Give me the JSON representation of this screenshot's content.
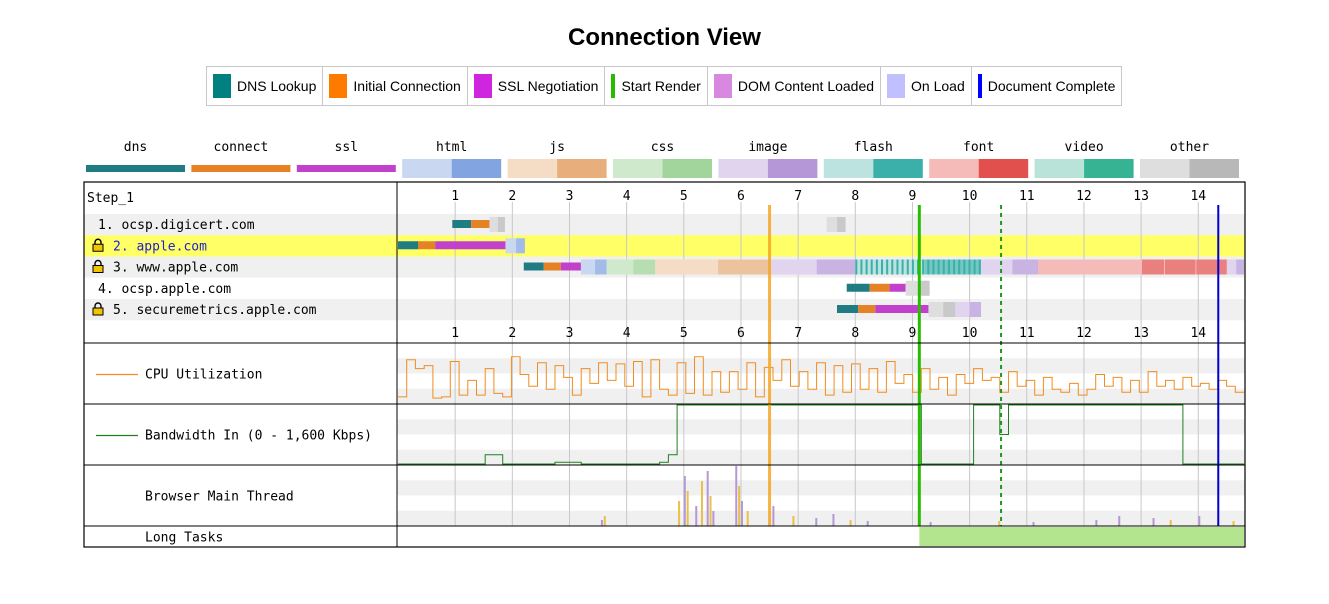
{
  "title": "Connection View",
  "legend": [
    {
      "label": "DNS Lookup",
      "color": "#008080",
      "kind": "box"
    },
    {
      "label": "Initial Connection",
      "color": "#ff7b00",
      "kind": "box"
    },
    {
      "label": "SSL Negotiation",
      "color": "#cf25df",
      "kind": "box"
    },
    {
      "label": "Start Render",
      "color": "#28bc00",
      "kind": "line"
    },
    {
      "label": "DOM Content Loaded",
      "color": "#d888df",
      "kind": "box"
    },
    {
      "label": "On Load",
      "color": "#c0c0ff",
      "kind": "box"
    },
    {
      "label": "Document Complete",
      "color": "#0000ff",
      "kind": "line"
    }
  ],
  "type_legend": [
    {
      "label": "dns",
      "light": "#1f7c83",
      "dark": "#1f7c83",
      "solid": true
    },
    {
      "label": "connect",
      "light": "#e58226",
      "dark": "#e58226",
      "solid": true
    },
    {
      "label": "ssl",
      "light": "#c141cd",
      "dark": "#c141cd",
      "solid": true
    },
    {
      "label": "html",
      "light": "#c9d7f1",
      "dark": "#82a4e0"
    },
    {
      "label": "js",
      "light": "#f4dcc5",
      "dark": "#e8ae7b"
    },
    {
      "label": "css",
      "light": "#cfe9cc",
      "dark": "#a2d59b"
    },
    {
      "label": "image",
      "light": "#e0d4ef",
      "dark": "#b597d7"
    },
    {
      "label": "flash",
      "light": "#bde3e1",
      "dark": "#3bb0aa"
    },
    {
      "label": "font",
      "light": "#f4bbb8",
      "dark": "#e2504d"
    },
    {
      "label": "video",
      "light": "#b9e2d9",
      "dark": "#36b392"
    },
    {
      "label": "other",
      "light": "#dedede",
      "dark": "#b8b8b8"
    }
  ],
  "step_label": "Step_1",
  "rows": [
    {
      "label": "1. ocsp.digicert.com",
      "secure": false,
      "highlight": false
    },
    {
      "label": "2. apple.com",
      "secure": true,
      "highlight": true
    },
    {
      "label": "3. www.apple.com",
      "secure": true,
      "highlight": false
    },
    {
      "label": "4. ocsp.apple.com",
      "secure": false,
      "highlight": false
    },
    {
      "label": "5. securemetrics.apple.com",
      "secure": true,
      "highlight": false
    }
  ],
  "metric_rows": [
    {
      "label": "CPU Utilization",
      "color": "#f28c1f"
    },
    {
      "label": "Bandwidth In (0 - 1,600 Kbps)",
      "color": "#208020"
    },
    {
      "label": "Browser Main Thread",
      "color": ""
    },
    {
      "label": "Long Tasks",
      "color": ""
    }
  ],
  "chart_data": {
    "type": "waterfall",
    "x_unit": "seconds",
    "xlim": [
      0,
      14.8
    ],
    "ticks": [
      1,
      2,
      3,
      4,
      5,
      6,
      7,
      8,
      9,
      10,
      11,
      12,
      13,
      14
    ],
    "events": {
      "start_render": 9.12,
      "dom_content_loaded_dashed": 10.55,
      "document_complete": 14.35,
      "orange_marker": 6.5
    },
    "connections": [
      {
        "row": 0,
        "segments": [
          {
            "kind": "dns",
            "start": 0.95,
            "end": 1.28
          },
          {
            "kind": "connect",
            "start": 1.28,
            "end": 1.6
          },
          {
            "kind": "other",
            "start": 1.6,
            "end": 1.87
          },
          {
            "kind": "other",
            "start": 7.5,
            "end": 7.83
          }
        ]
      },
      {
        "row": 1,
        "segments": [
          {
            "kind": "dns",
            "start": 0.0,
            "end": 0.35
          },
          {
            "kind": "connect",
            "start": 0.35,
            "end": 0.65
          },
          {
            "kind": "ssl",
            "start": 0.65,
            "end": 1.88
          },
          {
            "kind": "html",
            "start": 1.88,
            "end": 2.22
          }
        ]
      },
      {
        "row": 2,
        "segments": [
          {
            "kind": "dns",
            "start": 2.2,
            "end": 2.55
          },
          {
            "kind": "connect",
            "start": 2.55,
            "end": 2.85
          },
          {
            "kind": "ssl",
            "start": 2.85,
            "end": 3.2
          },
          {
            "kind": "html",
            "start": 3.2,
            "end": 3.65
          },
          {
            "kind": "css",
            "start": 3.65,
            "end": 4.5
          },
          {
            "kind": "js",
            "start": 4.5,
            "end": 6.5
          },
          {
            "kind": "image",
            "start": 6.5,
            "end": 8.0
          },
          {
            "kind": "flash",
            "start": 8.0,
            "end": 10.2
          },
          {
            "kind": "image",
            "start": 10.2,
            "end": 11.2
          },
          {
            "kind": "font",
            "start": 11.2,
            "end": 14.5
          },
          {
            "kind": "image",
            "start": 14.5,
            "end": 14.8
          }
        ]
      },
      {
        "row": 3,
        "segments": [
          {
            "kind": "dns",
            "start": 7.85,
            "end": 8.25
          },
          {
            "kind": "connect",
            "start": 8.25,
            "end": 8.6
          },
          {
            "kind": "ssl",
            "start": 8.6,
            "end": 8.88
          },
          {
            "kind": "other",
            "start": 8.88,
            "end": 9.3
          }
        ]
      },
      {
        "row": 4,
        "segments": [
          {
            "kind": "dns",
            "start": 7.68,
            "end": 8.05
          },
          {
            "kind": "connect",
            "start": 8.05,
            "end": 8.35
          },
          {
            "kind": "ssl",
            "start": 8.35,
            "end": 9.28
          },
          {
            "kind": "other",
            "start": 9.28,
            "end": 9.75
          },
          {
            "kind": "image",
            "start": 9.75,
            "end": 10.2
          }
        ]
      }
    ],
    "cpu_utilization_pct": [
      12,
      75,
      60,
      65,
      10,
      12,
      72,
      15,
      40,
      15,
      60,
      18,
      12,
      80,
      50,
      30,
      70,
      25,
      65,
      45,
      15,
      60,
      35,
      70,
      40,
      68,
      30,
      72,
      12,
      75,
      25,
      15,
      70,
      18,
      80,
      15,
      55,
      20,
      55,
      25,
      70,
      12,
      62,
      40,
      75,
      30,
      55,
      25,
      70,
      15,
      65,
      20,
      68,
      25,
      60,
      20,
      72,
      35,
      50,
      20,
      60,
      25,
      45,
      15,
      50,
      35,
      60,
      40,
      45,
      20,
      55,
      30,
      40,
      15,
      45,
      25,
      20,
      35,
      15,
      25,
      50,
      30,
      45,
      20,
      40,
      20,
      55,
      30,
      40,
      25,
      45,
      30,
      35,
      25,
      40,
      30,
      20
    ],
    "bandwidth_in_kbps": [
      0,
      0,
      0,
      0,
      0,
      0,
      0,
      0,
      0,
      0,
      250,
      250,
      0,
      0,
      0,
      0,
      0,
      0,
      50,
      50,
      50,
      0,
      0,
      0,
      0,
      0,
      0,
      0,
      0,
      0,
      50,
      250,
      1600,
      1600,
      1600,
      1600,
      1600,
      1600,
      1600,
      1600,
      1600,
      1600,
      1600,
      1600,
      1600,
      1600,
      1600,
      1600,
      1600,
      1600,
      1600,
      1600,
      1600,
      1600,
      1600,
      1600,
      1600,
      1600,
      1600,
      1600,
      0,
      0,
      0,
      0,
      0,
      0,
      1600,
      1600,
      1600,
      800,
      1600,
      1600,
      1600,
      1600,
      1600,
      1600,
      1600,
      1600,
      1600,
      1600,
      1600,
      1600,
      1600,
      1600,
      1600,
      1600,
      1600,
      1600,
      1600,
      1600,
      0,
      0,
      0,
      0,
      0,
      0,
      0
    ],
    "long_tasks": [
      {
        "start": 9.12,
        "end": 14.8
      }
    ]
  }
}
